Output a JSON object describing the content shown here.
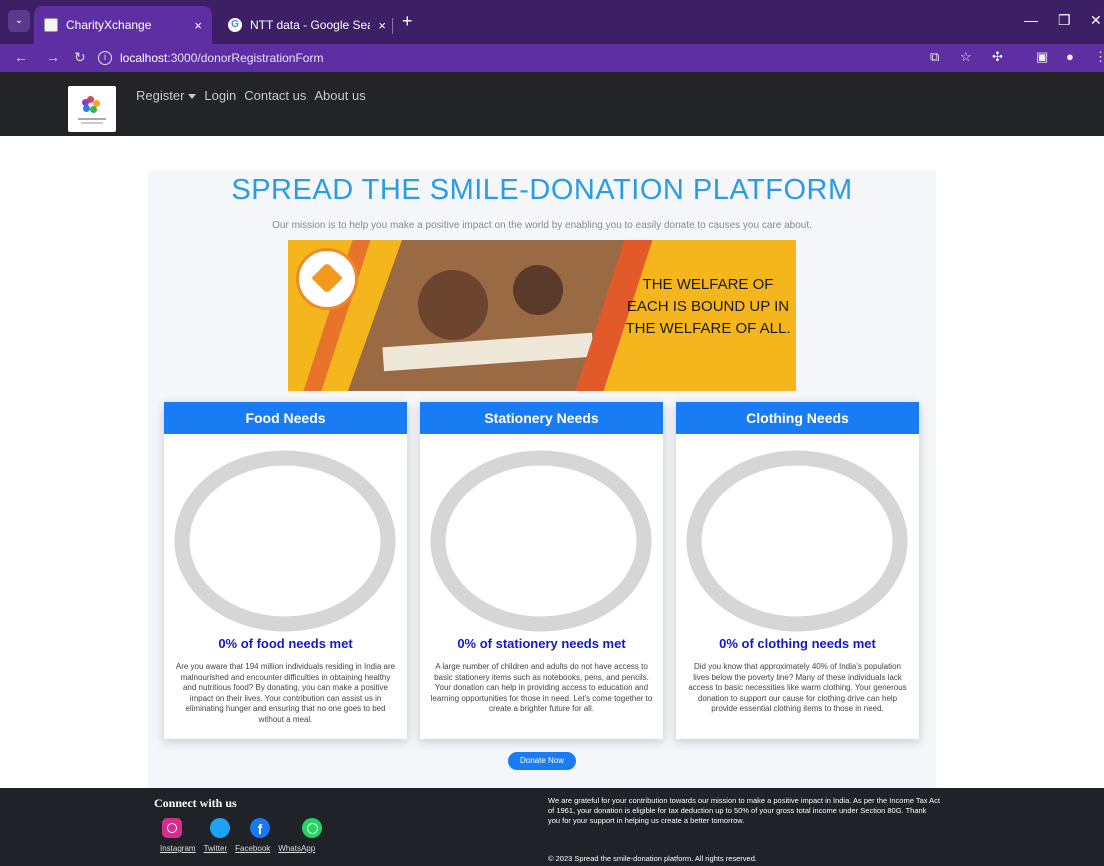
{
  "browser": {
    "tabs": [
      {
        "title": "CharityXchange",
        "close": "×"
      },
      {
        "title": "NTT data - Google Search",
        "close": "×"
      }
    ],
    "new_tab": "+",
    "url_host": "localhost",
    "url_path": ":3000/donorRegistrationForm"
  },
  "navbar": {
    "register": "Register",
    "login": "Login",
    "contact": "Contact us",
    "about": "About us"
  },
  "hero": {
    "title": "SPREAD THE SMILE-DONATION PLATFORM",
    "subtitle": "Our mission is to help you make a positive impact on the world by enabling you to easily donate to causes you care about."
  },
  "banner": {
    "quote": "THE WELFARE OF EACH IS BOUND UP IN THE WELFARE OF ALL."
  },
  "cards": [
    {
      "heading": "Food Needs",
      "stat": "0% of food needs met",
      "progress": 0,
      "description": "Are you aware that 194 million individuals residing in India are malnourished and encounter difficulties in obtaining healthy and nutritious food? By donating, you can make a positive impact on their lives. Your contribution can assist us in eliminating hunger and ensuring that no one goes to bed without a meal."
    },
    {
      "heading": "Stationery Needs",
      "stat": "0% of stationery needs met",
      "progress": 0,
      "description": "A large number of children and adults do not have access to basic stationery items such as notebooks, pens, and pencils. Your donation can help in providing access to education and learning opportunities for those in need. Let's come together to create a brighter future for all."
    },
    {
      "heading": "Clothing Needs",
      "stat": "0% of clothing needs met",
      "progress": 0,
      "description": "Did you know that approximately 40% of India's population lives below the poverty line? Many of these individuals lack access to basic necessities like warm clothing. Your generous donation to support our cause for clothing drive can help provide essential clothing items to those in need."
    }
  ],
  "donate_button": "Donate Now",
  "footer": {
    "connect": "Connect with us",
    "social": [
      "Instagram",
      "Twitter",
      "Facebook",
      "WhatsApp"
    ],
    "message": "We are grateful for your contribution towards our mission to make a positive impact in India. As per the Income Tax Act of 1961, your donation is eligible for tax deduction up to 50% of your gross total income under Section 80G. Thank you for your support in helping us create a better tomorrow.",
    "copyright": "© 2023 Spread the smile-donation platform. All rights reserved."
  },
  "colors": {
    "brand_blue": "#1a7cf5",
    "title_blue": "#2a9be8",
    "stat_blue": "#1418c8",
    "ring_gray": "#d6d6d6",
    "ring_fill": "#1a7cf5"
  }
}
